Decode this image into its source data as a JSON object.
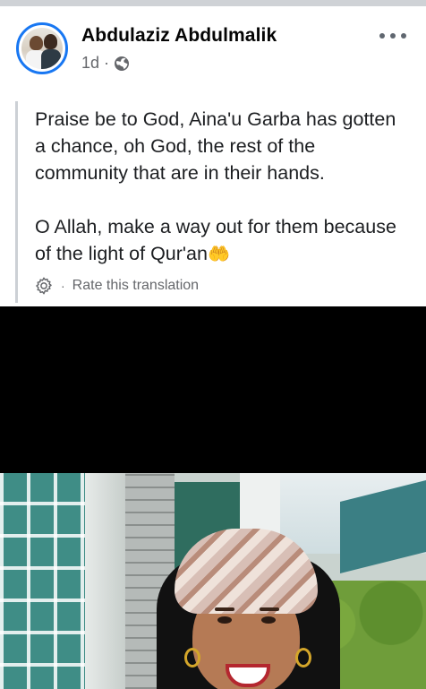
{
  "post": {
    "author": "Abdulaziz Abdulmalik",
    "time": "1d",
    "meta_separator": "·",
    "privacy_icon": "globe-icon",
    "more_icon": "more-options-icon"
  },
  "translation": {
    "paragraph1": "Praise be to God, Aina'u Garba has gotten a chance, oh God, the rest of the community that are in their hands.",
    "paragraph2": "O Allah, make a way out for them because of the light of Qur'an",
    "paragraph2_emoji": "🤲",
    "rate_separator": "·",
    "rate_label": "Rate this translation",
    "settings_icon": "gear-icon"
  },
  "colors": {
    "accent": "#1877f2",
    "secondary_text": "#65676b",
    "quote_bar": "#ccd0d5",
    "video_background": "#000000"
  }
}
